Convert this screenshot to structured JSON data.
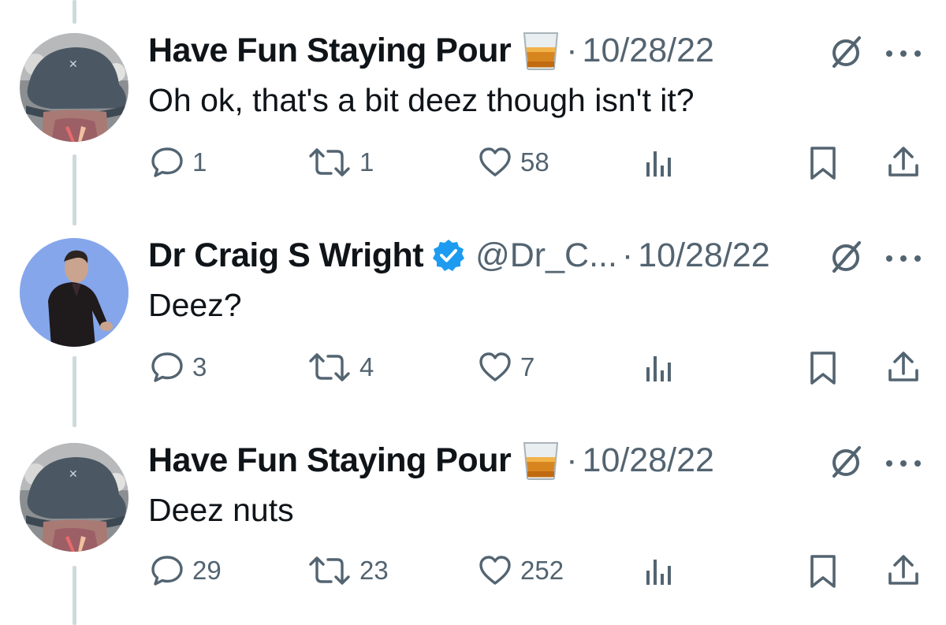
{
  "colors": {
    "text": "#0f1419",
    "secondary": "#536471",
    "verified": "#1d9bf0",
    "thread_line": "#cfd9de"
  },
  "tweets": [
    {
      "display_name": "Have Fun Staying Pour",
      "emoji_icon": "whiskey-tumbler-icon",
      "verified": false,
      "handle": "",
      "separator": "·",
      "date": "10/28/22",
      "text": "Oh ok, that's a bit deez though isn't it?",
      "replies": "1",
      "reposts": "1",
      "likes": "58"
    },
    {
      "display_name": "Dr Craig S Wright",
      "emoji_icon": "",
      "verified": true,
      "handle": "@Dr_C...",
      "separator": "·",
      "date": "10/28/22",
      "text": "Deez?",
      "replies": "3",
      "reposts": "4",
      "likes": "7"
    },
    {
      "display_name": "Have Fun Staying Pour",
      "emoji_icon": "whiskey-tumbler-icon",
      "verified": false,
      "handle": "",
      "separator": "·",
      "date": "10/28/22",
      "text": "Deez nuts",
      "replies": "29",
      "reposts": "23",
      "likes": "252"
    }
  ]
}
